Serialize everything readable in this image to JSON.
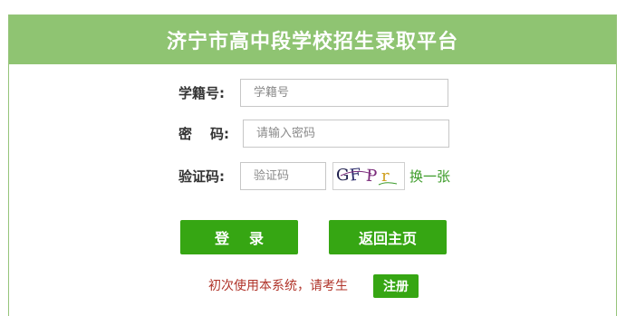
{
  "header": {
    "title": "济宁市高中段学校招生录取平台"
  },
  "form": {
    "student_id": {
      "label": "学籍号:",
      "placeholder": "学籍号"
    },
    "password": {
      "label_a": "密",
      "label_b": "码:",
      "placeholder": "请输入密码"
    },
    "captcha": {
      "label": "验证码:",
      "placeholder": "验证码",
      "image_text": [
        "G",
        "F",
        "P",
        "r"
      ],
      "image_colors": [
        "#1b1b4a",
        "#2b2b6a",
        "#7a2a7a",
        "#d0a020"
      ],
      "refresh_label": "换一张"
    }
  },
  "actions": {
    "login_label": "登录",
    "home_label": "返回主页"
  },
  "register": {
    "note": "初次使用本系统，请考生",
    "button_label": "注册"
  },
  "colors": {
    "header_bg": "#8fc472",
    "accent": "#36a613",
    "note": "#b0342a"
  }
}
